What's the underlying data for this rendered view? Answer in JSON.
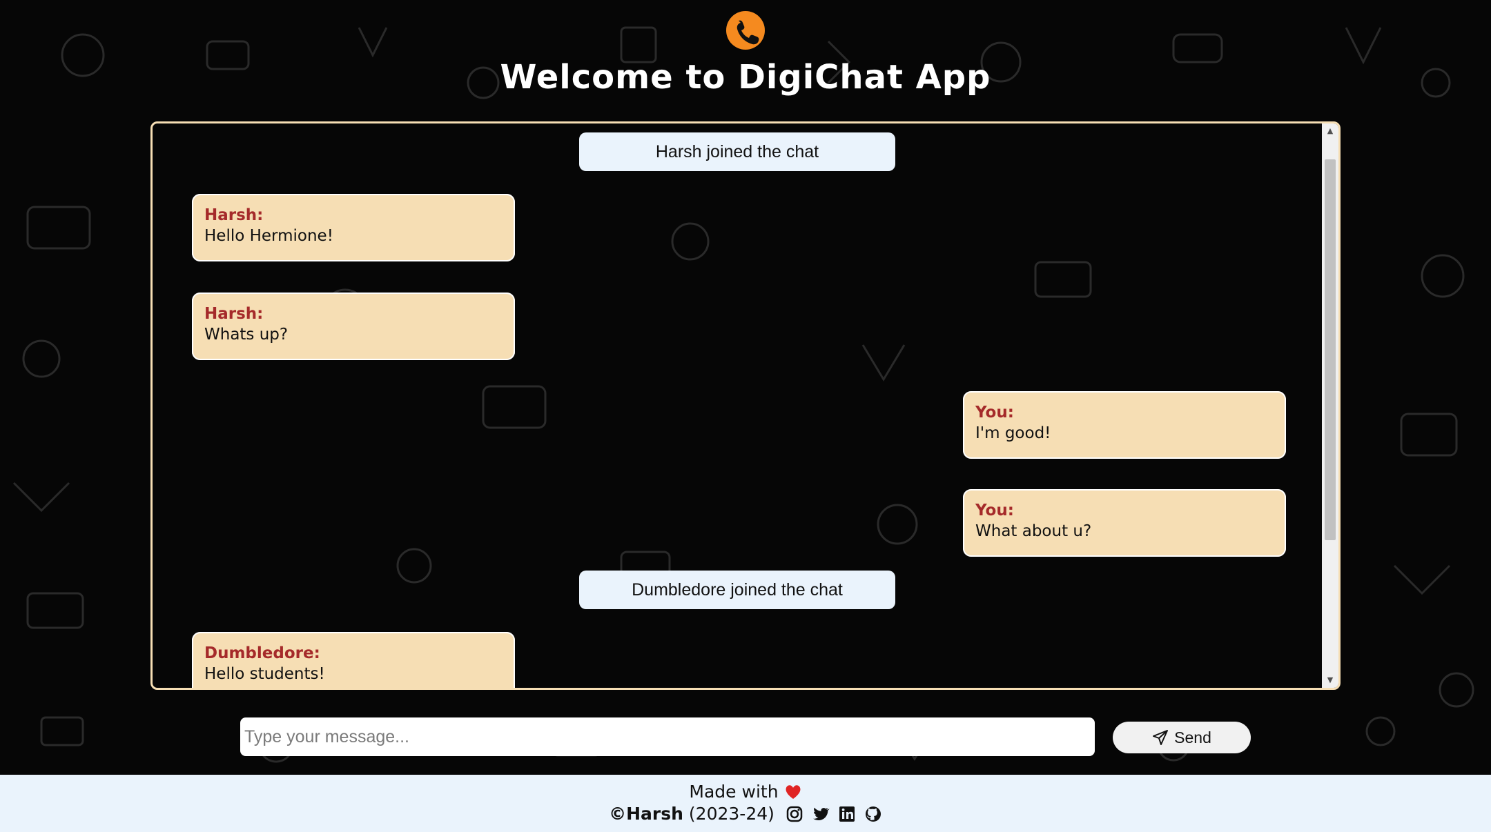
{
  "header": {
    "logo_icon": "whatsapp-phone-icon",
    "title": "Welcome to DigiChat App"
  },
  "chat": {
    "notice_1": "Harsh joined the chat",
    "notice_2": "Dumbledore joined the chat",
    "messages": [
      {
        "sender": "Harsh:",
        "text": "Hello Hermione!",
        "side": "left"
      },
      {
        "sender": "Harsh:",
        "text": "Whats up?",
        "side": "left"
      },
      {
        "sender": "You:",
        "text": "I'm good!",
        "side": "right"
      },
      {
        "sender": "You:",
        "text": "What about u?",
        "side": "right"
      },
      {
        "sender": "Dumbledore:",
        "text": "Hello students!",
        "side": "left"
      }
    ]
  },
  "composer": {
    "placeholder": "Type your message...",
    "send_label": "Send",
    "send_icon": "paper-plane-icon"
  },
  "footer": {
    "made_with": "Made with",
    "heart_icon": "heart-icon",
    "copyright": "©Harsh",
    "years": "(2023-24)",
    "social_icons": [
      "instagram-icon",
      "twitter-icon",
      "linkedin-icon",
      "github-icon"
    ]
  },
  "colors": {
    "accent": "#f58a1f",
    "bubble": "#f6deb4",
    "sender": "#a52a2a",
    "notice": "#eaf3fc",
    "background": "#050505"
  }
}
